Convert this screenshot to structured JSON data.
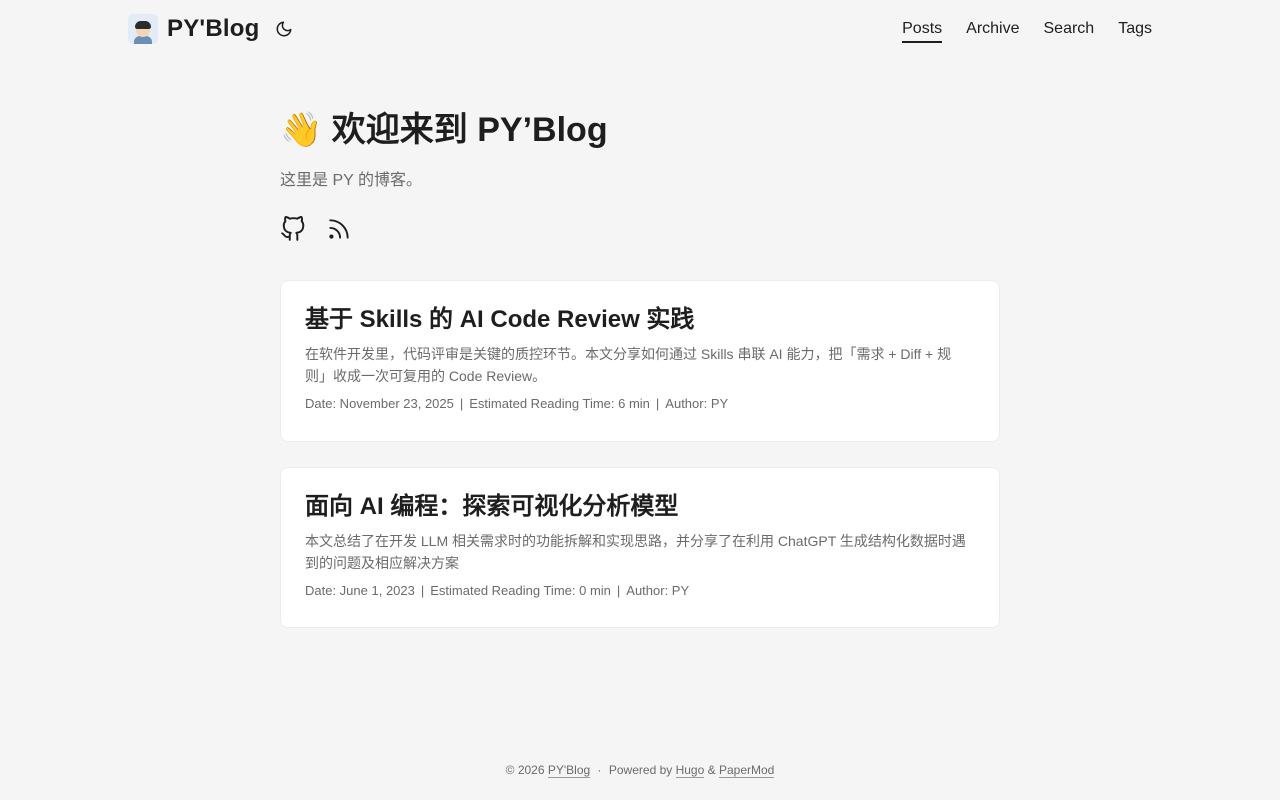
{
  "site": {
    "title": "PY'Blog"
  },
  "nav": {
    "items": [
      {
        "label": "Posts"
      },
      {
        "label": "Archive"
      },
      {
        "label": "Search"
      },
      {
        "label": "Tags"
      }
    ]
  },
  "hero": {
    "emoji": "👋",
    "title": "欢迎来到 PY’Blog",
    "subtitle": "这里是 PY 的博客。"
  },
  "socials": [
    {
      "icon": "github-icon"
    },
    {
      "icon": "rss-icon"
    }
  ],
  "posts": [
    {
      "title": "基于 Skills 的 AI Code Review 实践",
      "summary": "在软件开发里，代码评审是关键的质控环节。本文分享如何通过 Skills 串联 AI 能力，把「需求 + Diff + 规则」收成一次可复用的 Code Review。",
      "date": "Date: November 23, 2025",
      "reading_time": "Estimated Reading Time: 6 min",
      "author": "Author: PY",
      "separator": "|"
    },
    {
      "title": "面向 AI 编程：探索可视化分析模型",
      "summary": "本文总结了在开发 LLM 相关需求时的功能拆解和实现思路，并分享了在利用 ChatGPT 生成结构化数据时遇到的问题及相应解决方案",
      "date": "Date: June 1, 2023",
      "reading_time": "Estimated Reading Time: 0 min",
      "author": "Author: PY",
      "separator": "|"
    }
  ],
  "footer": {
    "copyright": "© 2026",
    "site_link": "PY'Blog",
    "dot": "·",
    "powered_by": "Powered by",
    "hugo_link": "Hugo",
    "amp": "&",
    "papermod_link": "PaperMod"
  },
  "colors": {
    "background": "#f5f5f5",
    "card": "#ffffff",
    "text_primary": "#1e1e1e",
    "text_secondary": "#6b6b6b"
  }
}
